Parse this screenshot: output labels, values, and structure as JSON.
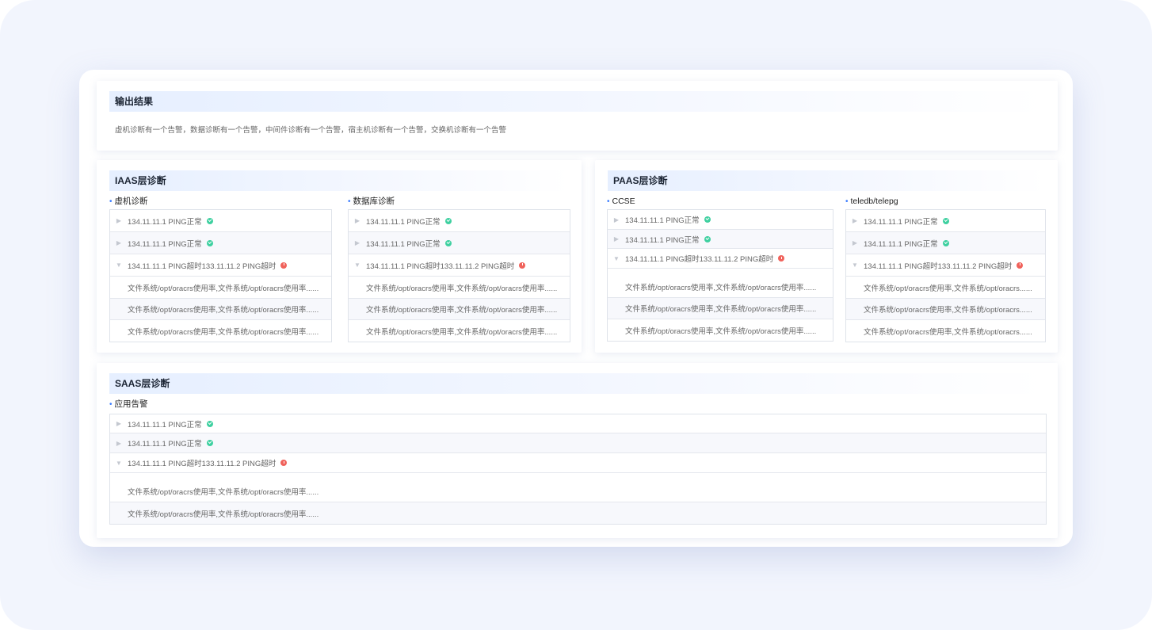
{
  "output": {
    "title": "输出结果",
    "summary": "虚机诊断有一个告警，数据诊断有一个告警，中间件诊断有一个告警，宿主机诊断有一个告警，交换机诊断有一个告警"
  },
  "iaas": {
    "title": "IAAS层诊断",
    "sections": [
      {
        "label": "虚机诊断",
        "items": [
          {
            "text": "134.11.11.1 PING正常",
            "status": "ok",
            "expanded": false
          },
          {
            "text": "134.11.11.1 PING正常",
            "status": "ok",
            "expanded": false
          },
          {
            "text": "134.11.11.1 PING超时133.11.11.2 PING超时",
            "status": "error",
            "expanded": true
          }
        ],
        "details": [
          "文件系统/opt/oracrs使用率,文件系统/opt/oracrs使用率......",
          "文件系统/opt/oracrs使用率,文件系统/opt/oracrs使用率......",
          "文件系统/opt/oracrs使用率,文件系统/opt/oracrs使用率......"
        ]
      },
      {
        "label": "数据库诊断",
        "items": [
          {
            "text": "134.11.11.1 PING正常",
            "status": "ok",
            "expanded": false
          },
          {
            "text": "134.11.11.1 PING正常",
            "status": "ok",
            "expanded": false
          },
          {
            "text": "134.11.11.1 PING超时133.11.11.2 PING超时",
            "status": "error",
            "expanded": true
          }
        ],
        "details": [
          "文件系统/opt/oracrs使用率,文件系统/opt/oracrs使用率......",
          "文件系统/opt/oracrs使用率,文件系统/opt/oracrs使用率......",
          "文件系统/opt/oracrs使用率,文件系统/opt/oracrs使用率......"
        ]
      }
    ]
  },
  "paas": {
    "title": "PAAS层诊断",
    "sections": [
      {
        "label": "CCSE",
        "items": [
          {
            "text": "134.11.11.1 PING正常",
            "status": "ok",
            "expanded": false
          },
          {
            "text": "134.11.11.1 PING正常",
            "status": "ok",
            "expanded": false
          },
          {
            "text": "134.11.11.1 PING超时133.11.11.2 PING超时",
            "status": "error",
            "expanded": true
          }
        ],
        "details": [
          "文件系统/opt/oracrs使用率,文件系统/opt/oracrs使用率......",
          "文件系统/opt/oracrs使用率,文件系统/opt/oracrs使用率......",
          "文件系统/opt/oracrs使用率,文件系统/opt/oracrs使用率......"
        ]
      },
      {
        "label": "teledb/telepg",
        "items": [
          {
            "text": "134.11.11.1 PING正常",
            "status": "ok",
            "expanded": false
          },
          {
            "text": "134.11.11.1 PING正常",
            "status": "ok",
            "expanded": false
          },
          {
            "text": "134.11.11.1 PING超时133.11.11.2 PING超时",
            "status": "error",
            "expanded": true
          }
        ],
        "details": [
          "文件系统/opt/oracrs使用率,文件系统/opt/oracrs......",
          "文件系统/opt/oracrs使用率,文件系统/opt/oracrs......",
          "文件系统/opt/oracrs使用率,文件系统/opt/oracrs......"
        ]
      }
    ]
  },
  "saas": {
    "title": "SAAS层诊断",
    "sections": [
      {
        "label": "应用告警",
        "items": [
          {
            "text": "134.11.11.1 PING正常",
            "status": "ok",
            "expanded": false
          },
          {
            "text": "134.11.11.1 PING正常",
            "status": "ok",
            "expanded": false
          },
          {
            "text": "134.11.11.1 PING超时133.11.11.2 PING超时",
            "status": "error",
            "expanded": true
          }
        ],
        "details": [
          "文件系统/opt/oracrs使用率,文件系统/opt/oracrs使用率......",
          "文件系统/opt/oracrs使用率,文件系统/opt/oracrs使用率......"
        ]
      }
    ]
  },
  "colors": {
    "ok": "#3ed0a0",
    "error": "#f0625b",
    "accent": "#3b7cff",
    "title_bg": "#e6efff"
  },
  "icons": {
    "collapsed": "caret-right-icon",
    "expanded": "caret-down-icon",
    "ok": "check-circle-icon",
    "error": "exclamation-circle-icon"
  }
}
